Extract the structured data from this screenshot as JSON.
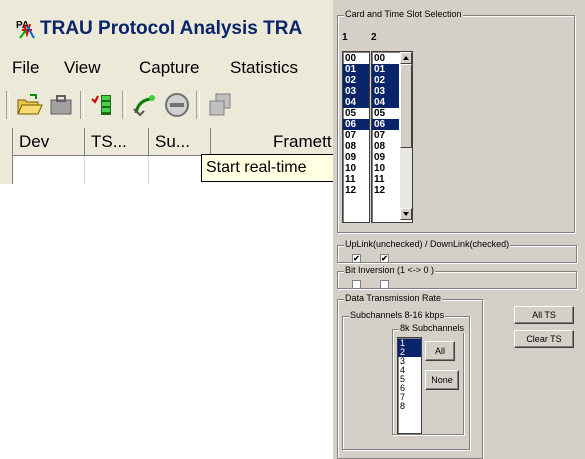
{
  "app": {
    "title": "TRAU Protocol Analysis TRA",
    "menu": [
      "File",
      "View",
      "Capture",
      "Statistics"
    ],
    "columns": [
      "Dev",
      "TS...",
      "Su...",
      "Framett"
    ],
    "tooltip": "Start real-time"
  },
  "toolbar_icons": [
    "open-folder-icon",
    "briefcase-icon",
    "checklist-icon",
    "start-capture-icon",
    "stop-icon",
    "copy-icon"
  ],
  "panel": {
    "card_group_label": "Card and Time Slot Selection",
    "col1_label": "1",
    "col2_label": "2",
    "timeslots": [
      "00",
      "01",
      "02",
      "03",
      "04",
      "05",
      "06",
      "07",
      "08",
      "09",
      "10",
      "11",
      "12"
    ],
    "list1_selected": [
      false,
      true,
      true,
      true,
      true,
      false,
      true,
      false,
      false,
      false,
      false,
      false,
      false
    ],
    "list2_selected": [
      false,
      true,
      true,
      true,
      true,
      false,
      true,
      false,
      false,
      false,
      false,
      false,
      false
    ],
    "uplink_label": "UpLink(unchecked) / DownLink(checked)",
    "uplink_checks": [
      true,
      true
    ],
    "bitinv_label": "Bit Inversion (1 <-> 0 )",
    "bitinv_checks": [
      false,
      false
    ],
    "rate_label": "Data Transmission Rate",
    "subch_label": "Subchannels 8-16 kbps",
    "k8_label": "8k Subchannels",
    "subchannels": [
      "1",
      "2",
      "3",
      "4",
      "5",
      "6",
      "7",
      "8"
    ],
    "subch_selected": [
      true,
      true,
      false,
      false,
      false,
      false,
      false,
      false
    ],
    "btn_all": "All",
    "btn_none": "None",
    "btn_all_ts": "All TS",
    "btn_clear_ts": "Clear TS"
  },
  "colors": {
    "selection": "#0a246a",
    "tooltip_bg": "#ffffe1",
    "panel_bg": "#d4d0c8"
  }
}
